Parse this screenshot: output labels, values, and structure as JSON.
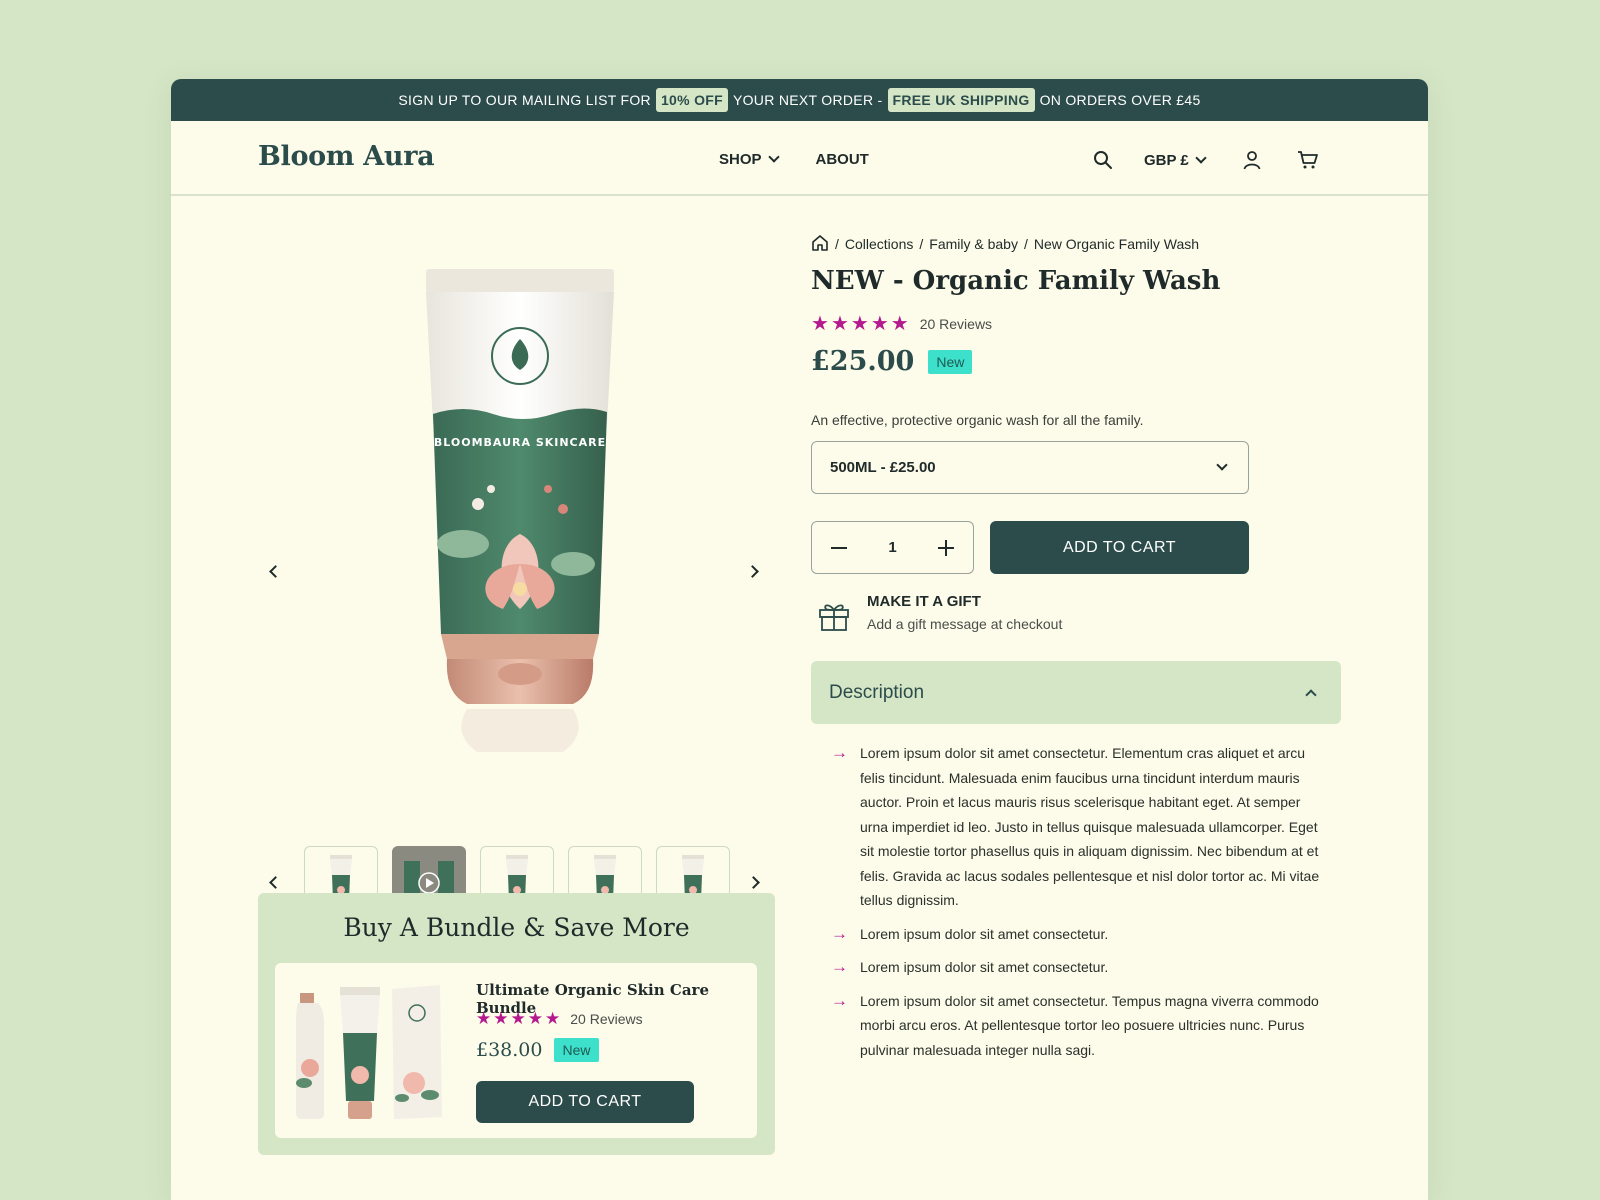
{
  "promo": {
    "part1": "SIGN UP TO OUR MAILING LIST FOR",
    "highlight1": "10% OFF",
    "part2": "YOUR NEXT ORDER -",
    "highlight2": "FREE UK SHIPPING",
    "part3": "ON ORDERS OVER £45"
  },
  "header": {
    "logo": "Bloom Aura",
    "menu": [
      {
        "label": "SHOP",
        "has_dropdown": true
      },
      {
        "label": "ABOUT",
        "has_dropdown": false
      }
    ],
    "currency": "GBP £",
    "icons": [
      "search-icon",
      "user-icon",
      "cart-icon"
    ]
  },
  "breadcrumb": {
    "home_icon": "home-icon",
    "items": [
      "Collections",
      "Family & baby",
      "New Organic Family Wash"
    ],
    "separator": "/"
  },
  "product": {
    "title": "NEW - Organic Family Wash",
    "rating": 5,
    "reviews": "20 Reviews",
    "price": "£25.00",
    "badge": "New",
    "tagline": "An effective, protective organic wash for all the family.",
    "variant": "500ML - £25.00",
    "quantity": "1",
    "add_to_cart": "ADD TO CART"
  },
  "gift": {
    "title": "MAKE IT A GIFT",
    "subtitle": "Add a gift message at checkout"
  },
  "description": {
    "heading": "Description",
    "expanded": true,
    "items": [
      "Lorem ipsum dolor sit amet consectetur. Elementum cras aliquet et arcu felis tincidunt. Malesuada enim faucibus urna tincidunt interdum mauris auctor. Proin et lacus mauris risus scelerisque habitant eget. At semper urna imperdiet id leo. Justo in tellus quisque malesuada ullamcorper. Eget sit molestie tortor phasellus quis in aliquam dignissim. Nec bibendum at et felis. Gravida ac lacus sodales pellentesque et nisl dolor tortor ac. Mi vitae tellus dignissim.",
      "Lorem ipsum dolor sit amet consectetur.",
      "Lorem ipsum dolor sit amet consectetur.",
      "Lorem ipsum dolor sit amet consectetur. Tempus magna viverra commodo morbi arcu eros. At pellentesque tortor leo posuere ultricies nunc. Purus pulvinar malesuada integer nulla sagi."
    ]
  },
  "gallery": {
    "product_label": "BLOOMBAURA SKINCARE",
    "thumbnail_count": 5,
    "active_thumbnail": 2
  },
  "bundle": {
    "heading": "Buy A Bundle & Save More",
    "name": "Ultimate Organic Skin Care Bundle",
    "rating": 5,
    "reviews": "20 Reviews",
    "price": "£38.00",
    "badge": "New",
    "add_to_cart": "ADD TO CART"
  },
  "colors": {
    "page_bg": "#d5e6c6",
    "panel_bg": "#fdfbe9",
    "brand_dark": "#2c4c4b",
    "star": "#b5198f",
    "badge": "#3de0cb"
  }
}
